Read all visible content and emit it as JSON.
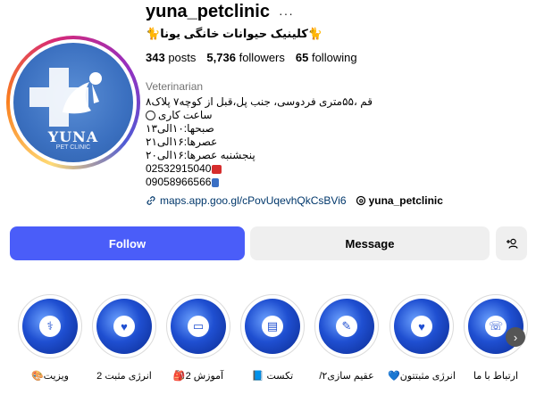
{
  "profile": {
    "username": "yuna_petclinic",
    "more_label": "···",
    "full_name": "🐈کلینیک حیوانات خانگی یونا🐈",
    "stats": {
      "posts_count": "343",
      "posts_label": "posts",
      "followers_count": "5,736",
      "followers_label": "followers",
      "following_count": "65",
      "following_label": "following"
    },
    "category": "Veterinarian",
    "bio_lines": [
      "قم ،۵۵متری فردوسی، جنب پل،قبل از کوچه۷ پلاک۸",
      "ساعت کاری",
      "صبحها:۱۰الی۱۳",
      "عصرها:۱۶الی۲۱",
      "پنجشنبه عصرها:۱۶الی۲۰",
      "02532915040",
      "09058966566"
    ],
    "link": "maps.app.goo.gl/cPovUqevhQkCsBVi6",
    "threads_handle": "yuna_petclinic",
    "avatar_text": "YUNA",
    "avatar_subtext": "PET CLINIC"
  },
  "actions": {
    "follow_label": "Follow",
    "message_label": "Message",
    "add_user_label": "+👤"
  },
  "highlights": [
    {
      "label": "ارتباط با ما",
      "icon": "phone-icon"
    },
    {
      "label": "انرژی مثبتتون💙",
      "icon": "heart-icon"
    },
    {
      "label": "عقیم سازی۲/",
      "icon": "syringe-icon"
    },
    {
      "label": "تکست 📘",
      "icon": "card-icon"
    },
    {
      "label": "آموزش 2🎒",
      "icon": "monitor-icon"
    },
    {
      "label": "انرژی مثبت 2",
      "icon": "heart-icon"
    },
    {
      "label": "ویزیت🎨",
      "icon": "stethoscope-icon"
    }
  ],
  "colors": {
    "follow_button": "#4a5df9",
    "secondary_button": "#efefef",
    "link": "#00376b",
    "highlight_blue": "#1f4fd1"
  }
}
